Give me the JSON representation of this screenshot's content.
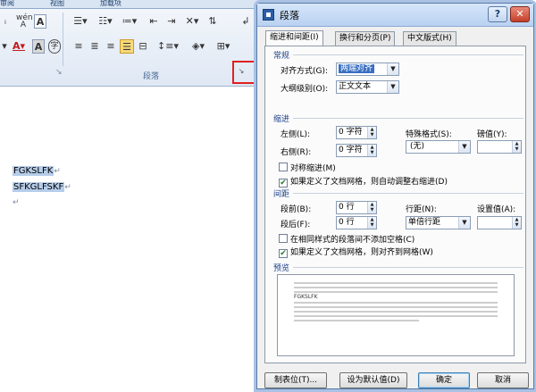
{
  "ribbon": {
    "tabs": [
      "审阅",
      "视图",
      "加载项"
    ],
    "group_label": "段落",
    "icons": {
      "font_color": "A",
      "char_shading": "A",
      "enclose_char": "字",
      "pinyin_top": "wén",
      "pinyin_bottom": "A"
    }
  },
  "document": {
    "lines": [
      "FGKSLFK",
      "SFKGLFSKF"
    ],
    "para_mark": "↵"
  },
  "dialog": {
    "title": "段落",
    "help_label": "?",
    "close_label": "✕",
    "tabs": [
      {
        "label": "缩进和间距(I)",
        "active": true
      },
      {
        "label": "换行和分页(P)",
        "active": false
      },
      {
        "label": "中文版式(H)",
        "active": false
      }
    ],
    "general": {
      "section": "常规",
      "alignment_label": "对齐方式(G):",
      "alignment_value": "两端对齐",
      "outline_label": "大纲级别(O):",
      "outline_value": "正文文本"
    },
    "indent": {
      "section": "缩进",
      "left_label": "左侧(L):",
      "left_value": "0 字符",
      "right_label": "右侧(R):",
      "right_value": "0 字符",
      "special_label": "特殊格式(S):",
      "special_value": "(无)",
      "by_label": "磅值(Y):",
      "by_value": "",
      "mirror_label": "对称缩进(M)",
      "mirror_checked": false,
      "autoadjust_label": "如果定义了文档网格，则自动调整右缩进(D)",
      "autoadjust_checked": true
    },
    "spacing": {
      "section": "间距",
      "before_label": "段前(B):",
      "before_value": "0 行",
      "after_label": "段后(F):",
      "after_value": "0 行",
      "line_label": "行距(N):",
      "line_value": "单倍行距",
      "at_label": "设置值(A):",
      "at_value": "",
      "nospace_label": "在相同样式的段落间不添加空格(C)",
      "nospace_checked": false,
      "snap_label": "如果定义了文档网格，则对齐到网格(W)",
      "snap_checked": true
    },
    "preview": {
      "section": "预览",
      "sample": "FGKSLFK"
    },
    "buttons": {
      "tabs": "制表位(T)...",
      "set_default": "设为默认值(D)",
      "ok": "确定",
      "cancel": "取消"
    }
  }
}
